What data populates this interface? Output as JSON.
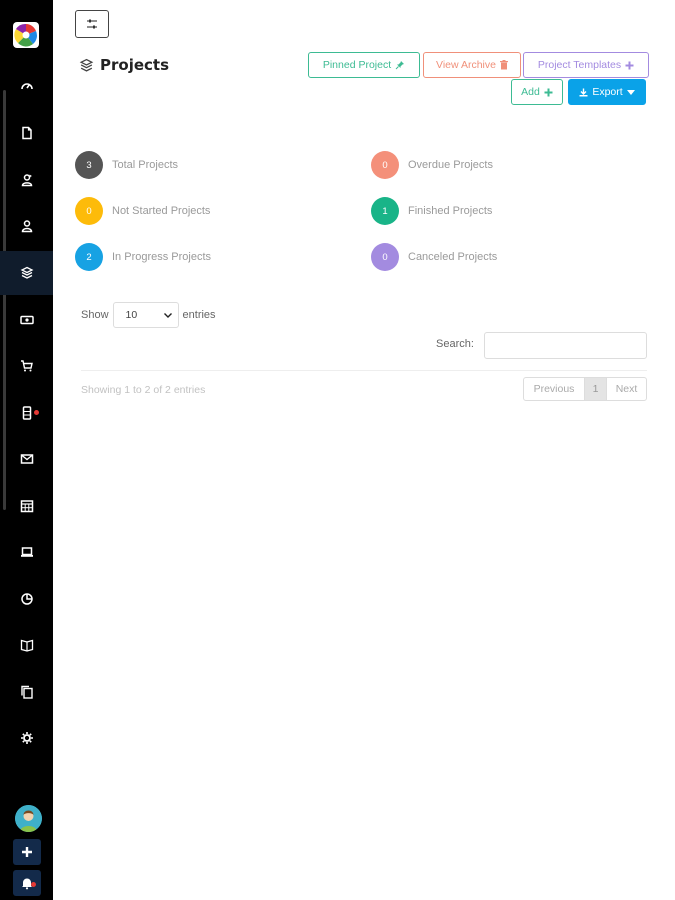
{
  "sidebar": {
    "items": [
      {
        "name": "dashboard",
        "icon": "gauge-icon",
        "active": false
      },
      {
        "name": "documents",
        "icon": "file-icon",
        "active": false
      },
      {
        "name": "clients",
        "icon": "users-icon",
        "active": false
      },
      {
        "name": "users",
        "icon": "user-icon",
        "active": false
      },
      {
        "name": "projects",
        "icon": "cube-icon",
        "active": true
      },
      {
        "name": "finance",
        "icon": "money-icon",
        "active": false
      },
      {
        "name": "sales",
        "icon": "cart-icon",
        "active": false
      },
      {
        "name": "devices",
        "icon": "phone-icon",
        "active": false,
        "badge": true
      },
      {
        "name": "messages",
        "icon": "envelope-icon",
        "active": false
      },
      {
        "name": "calendar",
        "icon": "calendar-icon",
        "active": false
      },
      {
        "name": "desktop",
        "icon": "laptop-icon",
        "active": false
      },
      {
        "name": "reports",
        "icon": "pie-chart-icon",
        "active": false
      },
      {
        "name": "knowledge-base",
        "icon": "book-icon",
        "active": false
      },
      {
        "name": "copy",
        "icon": "copy-icon",
        "active": false
      },
      {
        "name": "settings",
        "icon": "gear-icon",
        "active": false
      }
    ]
  },
  "header": {
    "title": "Projects",
    "buttons": {
      "pinned": "Pinned Project",
      "archive": "View Archive",
      "templates": "Project Templates",
      "add": "Add",
      "export": "Export"
    }
  },
  "stats": [
    {
      "count": "3",
      "label": "Total Projects",
      "color": "#555555"
    },
    {
      "count": "0",
      "label": "Overdue Projects",
      "color": "#f4907a"
    },
    {
      "count": "0",
      "label": "Not Started Projects",
      "color": "#fdbb0a"
    },
    {
      "count": "1",
      "label": "Finished Projects",
      "color": "#19b488"
    },
    {
      "count": "2",
      "label": "In Progress Projects",
      "color": "#17a2e3"
    },
    {
      "count": "0",
      "label": "Canceled Projects",
      "color": "#a38be0"
    }
  ],
  "table": {
    "show_label": "Show",
    "entries_value": "10",
    "entries_label": "entries",
    "search_label": "Search:",
    "search_value": "",
    "info": "Showing 1 to 2 of 2 entries",
    "pager": {
      "previous": "Previous",
      "page": "1",
      "next": "Next"
    }
  },
  "colors": {
    "sidebar_bg": "#000000",
    "active_item": "#101c2c",
    "primary": "#0aa2e8",
    "success": "#3dbb93",
    "danger": "#f0907a",
    "purple": "#a38be0"
  }
}
